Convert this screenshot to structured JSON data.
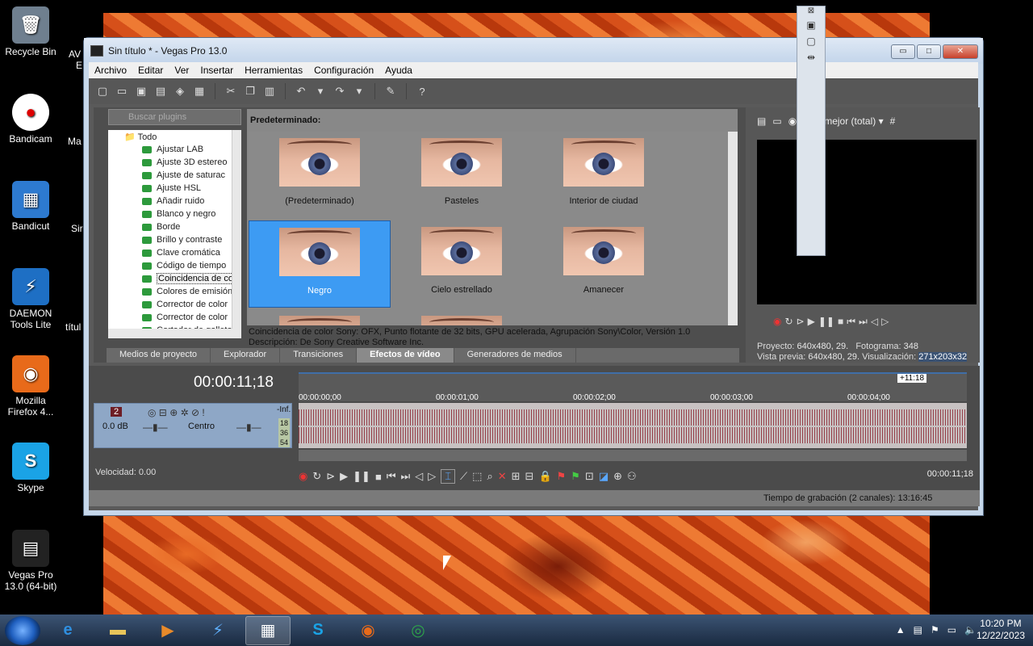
{
  "desktop": {
    "icons": [
      {
        "label": "Recycle Bin",
        "glyph": "🗑",
        "color": "#6f7f8f"
      },
      {
        "label": "Bandicam",
        "glyph": "●",
        "color": "#ffffff"
      },
      {
        "label": "Bandicut",
        "glyph": "▦",
        "color": "#2d7ad0"
      },
      {
        "label": "DAEMON Tools Lite",
        "glyph": "⚡",
        "color": "#1e6fc4"
      },
      {
        "label": "Mozilla Firefox 4...",
        "glyph": "◉",
        "color": "#e86a1a"
      },
      {
        "label": "Skype",
        "glyph": "S",
        "color": "#1aa3e6"
      },
      {
        "label": "Vegas Pro 13.0 (64-bit)",
        "glyph": "▤",
        "color": "#222222"
      }
    ],
    "partials": [
      "AV",
      "E",
      "Ma",
      "Sir",
      "títul"
    ]
  },
  "window": {
    "title": "Sin título * - Vegas Pro 13.0",
    "controls": {
      "minimize": "▭",
      "maximize": "□",
      "close": "✕"
    },
    "menu": [
      "Archivo",
      "Editar",
      "Ver",
      "Insertar",
      "Herramientas",
      "Configuración",
      "Ayuda"
    ]
  },
  "plugins": {
    "search_placeholder": "Buscar plugins",
    "root": "Todo",
    "items": [
      "Ajustar LAB",
      "Ajuste 3D estereo",
      "Ajuste de saturac",
      "Ajuste HSL",
      "Añadir ruido",
      "Blanco y negro",
      "Borde",
      "Brillo y contraste",
      "Clave cromática",
      "Código de tiempo",
      "Coincidencia de co",
      "Colores de emisión",
      "Corrector de color",
      "Corrector de color",
      "Cortador de galleta"
    ],
    "selected_index": 10
  },
  "presets": {
    "heading": "Predeterminado:",
    "items": [
      "(Predeterminado)",
      "Pasteles",
      "Interior de ciudad",
      "Negro",
      "Cielo estrellado",
      "Amanecer",
      "",
      ""
    ],
    "selected_index": 3
  },
  "description": {
    "line1": "Coincidencia de color Sony: OFX, Punto flotante de 32 bits, GPU acelerada, Agrupación Sony\\Color, Versión 1.0",
    "line2": "Descripción: De Sony Creative Software Inc."
  },
  "tabs": [
    "Medios de proyecto",
    "Explorador",
    "Transiciones",
    "Efectos de vídeo",
    "Generadores de medios"
  ],
  "active_tab": "Efectos de vídeo",
  "preview": {
    "quality": "La mejor (total)",
    "project_label": "Proyecto:",
    "project_value": "640x480, 29.",
    "frame_label": "Fotograma:",
    "frame_value": "348",
    "preview_label": "Vista previa:",
    "preview_value": "640x480, 29.",
    "display_label": "Visualización:",
    "display_value": "271x203x32"
  },
  "timeline": {
    "timecode": "00:00:11;18",
    "end_marker": "+11:18",
    "ruler": [
      "00:00:00;00",
      "00:00:01;00",
      "00:00:02;00",
      "00:00:03;00",
      "00:00:04;00"
    ],
    "track": {
      "number": "2",
      "volume": "0.0 dB",
      "pan": "Centro",
      "meter_top": "-Inf.",
      "meter_levels": [
        "18",
        "36",
        "54"
      ]
    },
    "velocity": "Velocidad: 0.00",
    "transport_timecode": "00:00:11;18",
    "status": "Tiempo de grabación (2 canales): 13:16:45"
  },
  "taskbar": {
    "time": "10:20 PM",
    "date": "12/22/2023",
    "apps": [
      {
        "name": "internet-explorer",
        "glyph": "e",
        "color": "#2f8fe0"
      },
      {
        "name": "file-explorer",
        "glyph": "▬",
        "color": "#e8c55a"
      },
      {
        "name": "media-player",
        "glyph": "▶",
        "color": "#e88a2a"
      },
      {
        "name": "daemon-tools",
        "glyph": "⚡",
        "color": "#5fb0ff"
      },
      {
        "name": "vegas-pro",
        "glyph": "▦",
        "color": "#ffffff"
      },
      {
        "name": "skype",
        "glyph": "S",
        "color": "#1aa3e6"
      },
      {
        "name": "firefox",
        "glyph": "◉",
        "color": "#e86a1a"
      },
      {
        "name": "chrome",
        "glyph": "◎",
        "color": "#2ea34a"
      }
    ],
    "active_app": "vegas-pro"
  }
}
